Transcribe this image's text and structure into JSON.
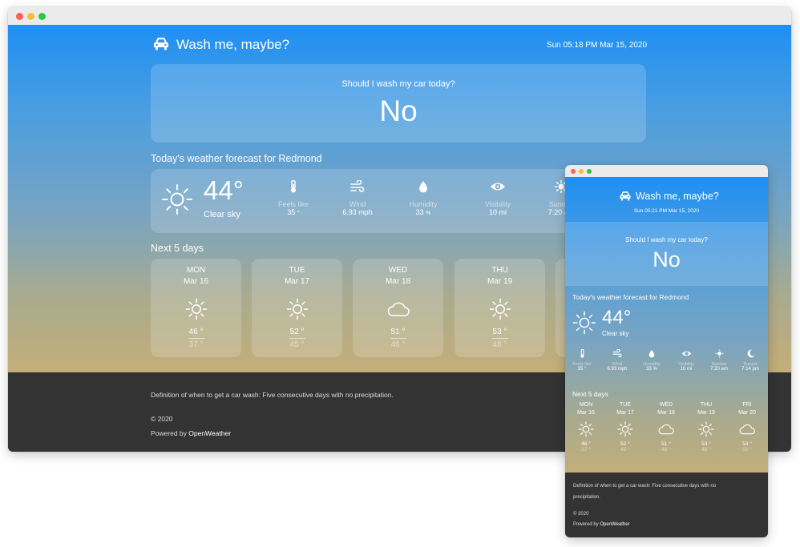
{
  "app": {
    "title": "Wash me, maybe?",
    "datetime_large": "Sun 05:18 PM Mar 15, 2020",
    "datetime_small": "Sun 05:21 PM Mar 15, 2020"
  },
  "decision": {
    "question": "Should I wash my car today?",
    "answer": "No"
  },
  "today": {
    "heading": "Today's weather forecast for Redmond",
    "icon": "sun-icon",
    "temperature": "44°",
    "condition": "Clear sky",
    "metrics": [
      {
        "icon": "thermometer-icon",
        "label": "Feels like",
        "value": "35",
        "unit": "°"
      },
      {
        "icon": "wind-icon",
        "label": "Wind",
        "value": "6.93",
        "unit": "mph"
      },
      {
        "icon": "droplet-icon",
        "label": "Humidity",
        "value": "33",
        "unit": "%"
      },
      {
        "icon": "eye-icon",
        "label": "Visibility",
        "value": "10",
        "unit": "mi"
      },
      {
        "icon": "sunrise-icon",
        "label": "Sunrise",
        "value": "7:20",
        "unit": "am"
      },
      {
        "icon": "moon-icon",
        "label": "Sunset",
        "value": "7:14",
        "unit": "pm"
      }
    ]
  },
  "forecast": {
    "heading": "Next 5 days",
    "days": [
      {
        "day": "MON",
        "date": "Mar 16",
        "icon": "sun-icon",
        "high": "46 °",
        "low": "37 °"
      },
      {
        "day": "TUE",
        "date": "Mar 17",
        "icon": "sun-icon",
        "high": "52 °",
        "low": "45 °"
      },
      {
        "day": "WED",
        "date": "Mar 18",
        "icon": "cloud-icon",
        "high": "51 °",
        "low": "46 °"
      },
      {
        "day": "THU",
        "date": "Mar 19",
        "icon": "sun-icon",
        "high": "53 °",
        "low": "48 °"
      },
      {
        "day": "FRI",
        "date": "Mar 20",
        "icon": "cloud-icon",
        "high": "54 °",
        "low": "50 °"
      }
    ]
  },
  "footer": {
    "definition": "Definition of when to get a car wash: Five consecutive days with no precipitation.",
    "definition_small_1": "Definition of when to get a car wash: Five consecutive days with no",
    "definition_small_2": "precipitation.",
    "copyright": "© 2020",
    "powered_prefix": "Powered by",
    "powered_link": "OpenWeather"
  },
  "colors": {
    "sky_top": "#1f8ff3",
    "sky_bottom": "#c4ae78",
    "footer_bg": "#333333",
    "titlebar_bg": "#ebebeb"
  }
}
